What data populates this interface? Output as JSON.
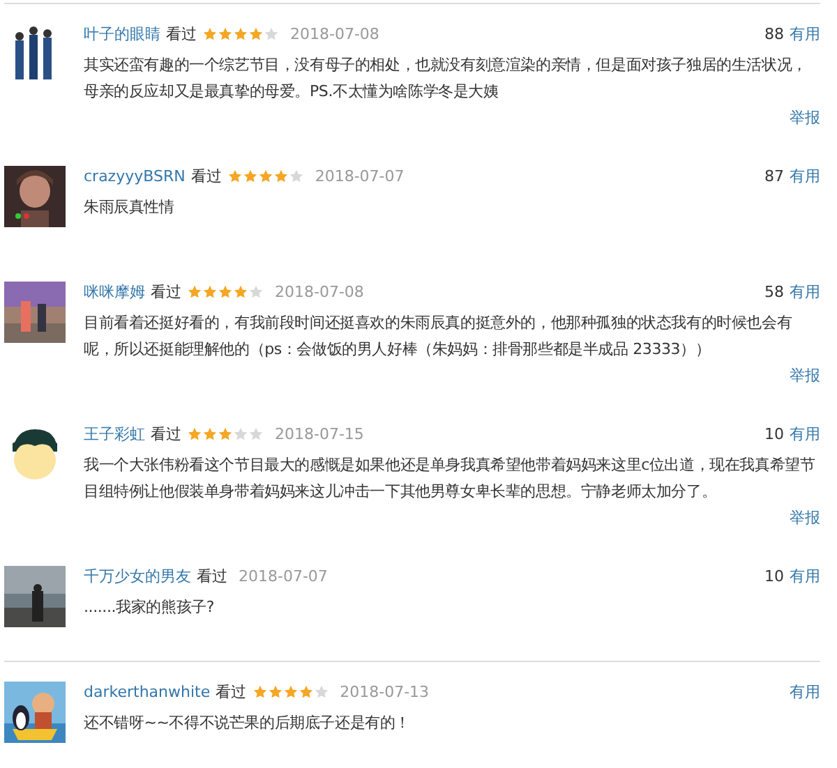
{
  "comments": [
    {
      "user": "叶子的眼睛",
      "status": "看过",
      "stars": 4,
      "date": "2018-07-08",
      "votes": "88",
      "useful": "有用",
      "text": "其实还蛮有趣的一个综艺节目，没有母子的相处，也就没有刻意渲染的亲情，但是面对孩子独居的生活状况，母亲的反应却又是最真挚的母爱。PS.不太懂为啥陈学冬是大姨",
      "report": "举报",
      "divider_above": true
    },
    {
      "user": "crazyyyBSRN",
      "status": "看过",
      "stars": 4,
      "date": "2018-07-07",
      "votes": "87",
      "useful": "有用",
      "text": "朱雨辰真性情",
      "divider_above": false
    },
    {
      "user": "咪咪摩姆",
      "status": "看过",
      "stars": 4,
      "date": "2018-07-08",
      "votes": "58",
      "useful": "有用",
      "text": "目前看着还挺好看的，有我前段时间还挺喜欢的朱雨辰真的挺意外的，他那种孤独的状态我有的时候也会有呢，所以还挺能理解他的（ps：会做饭的男人好棒（朱妈妈：排骨那些都是半成品 23333））",
      "report": "举报",
      "divider_above": false
    },
    {
      "user": "王子彩虹",
      "status": "看过",
      "stars": 3,
      "date": "2018-07-15",
      "votes": "10",
      "useful": "有用",
      "text": "我一个大张伟粉看这个节目最大的感慨是如果他还是单身我真希望他带着妈妈来这里c位出道，现在我真希望节目组特例让他假装单身带着妈妈来这儿冲击一下其他男尊女卑长辈的思想。宁静老师太加分了。",
      "report": "举报",
      "divider_above": false
    },
    {
      "user": "千万少女的男友",
      "status": "看过",
      "date": "2018-07-07",
      "votes": "10",
      "useful": "有用",
      "text": ".......我家的熊孩子?",
      "divider_above": false
    },
    {
      "user": "darkerthanwhite",
      "status": "看过",
      "stars": 4,
      "date": "2018-07-13",
      "useful": "有用",
      "text": "还不错呀~~不得不说芒果的后期底子还是有的！",
      "divider_above": true
    }
  ]
}
